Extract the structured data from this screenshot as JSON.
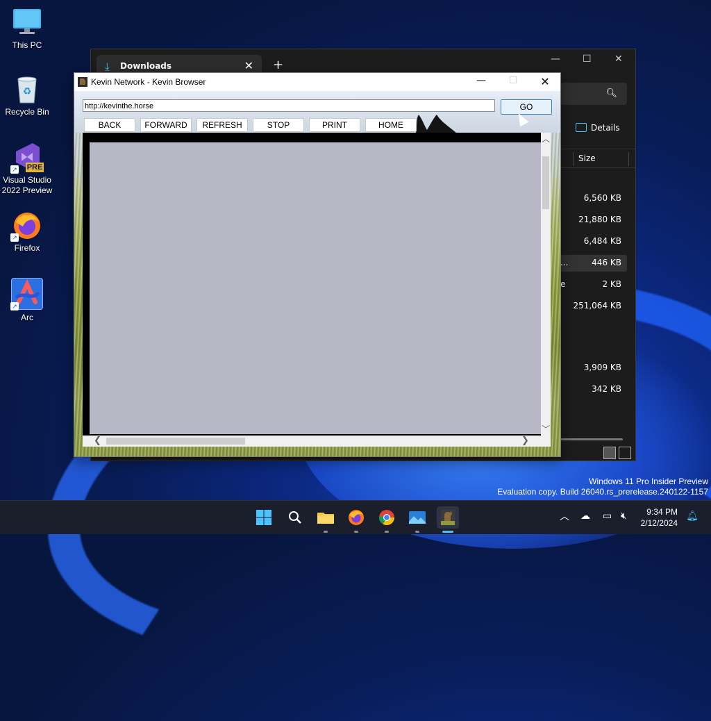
{
  "desktop": {
    "icons": [
      {
        "label": "This PC",
        "icon": "monitor-icon"
      },
      {
        "label": "Recycle Bin",
        "icon": "recycle-bin-icon"
      },
      {
        "label": "Visual Studio\n2022 Preview",
        "icon": "visual-studio-icon",
        "badge": "PRE"
      },
      {
        "label": "Firefox",
        "icon": "firefox-icon"
      },
      {
        "label": "Arc",
        "icon": "arc-icon"
      }
    ]
  },
  "explorer": {
    "tab_title": "Downloads",
    "new_tab": "+",
    "details_label": "Details",
    "column_size": "Size",
    "rows": [
      {
        "name": "",
        "size": "6,560 KB"
      },
      {
        "name": "",
        "size": "21,880 KB"
      },
      {
        "name": "",
        "size": "6,484 KB"
      },
      {
        "name": "...",
        "size": "446 KB",
        "selected": true
      },
      {
        "name": "e",
        "size": "2 KB"
      },
      {
        "name": "",
        "size": "251,064 KB"
      },
      {
        "name": "",
        "size": "3,909 KB"
      },
      {
        "name": "",
        "size": "342 KB"
      }
    ]
  },
  "browser": {
    "title": "Kevin Network - Kevin Browser",
    "url": "http://kevinthe.horse",
    "go_label": "GO",
    "nav": {
      "back": "BACK",
      "forward": "FORWARD",
      "refresh": "REFRESH",
      "stop": "STOP",
      "print": "PRINT",
      "home": "HOME"
    }
  },
  "watermark": {
    "line1": "Windows 11 Pro Insider Preview",
    "line2": "Evaluation copy. Build 26040.rs_prerelease.240122-1157"
  },
  "taskbar": {
    "time": "9:34 PM",
    "date": "2/12/2024"
  },
  "colors": {
    "accent": "#4cc2ff",
    "go_button_border": "#3c7fb1",
    "page_bg": "#b8b7c6"
  }
}
